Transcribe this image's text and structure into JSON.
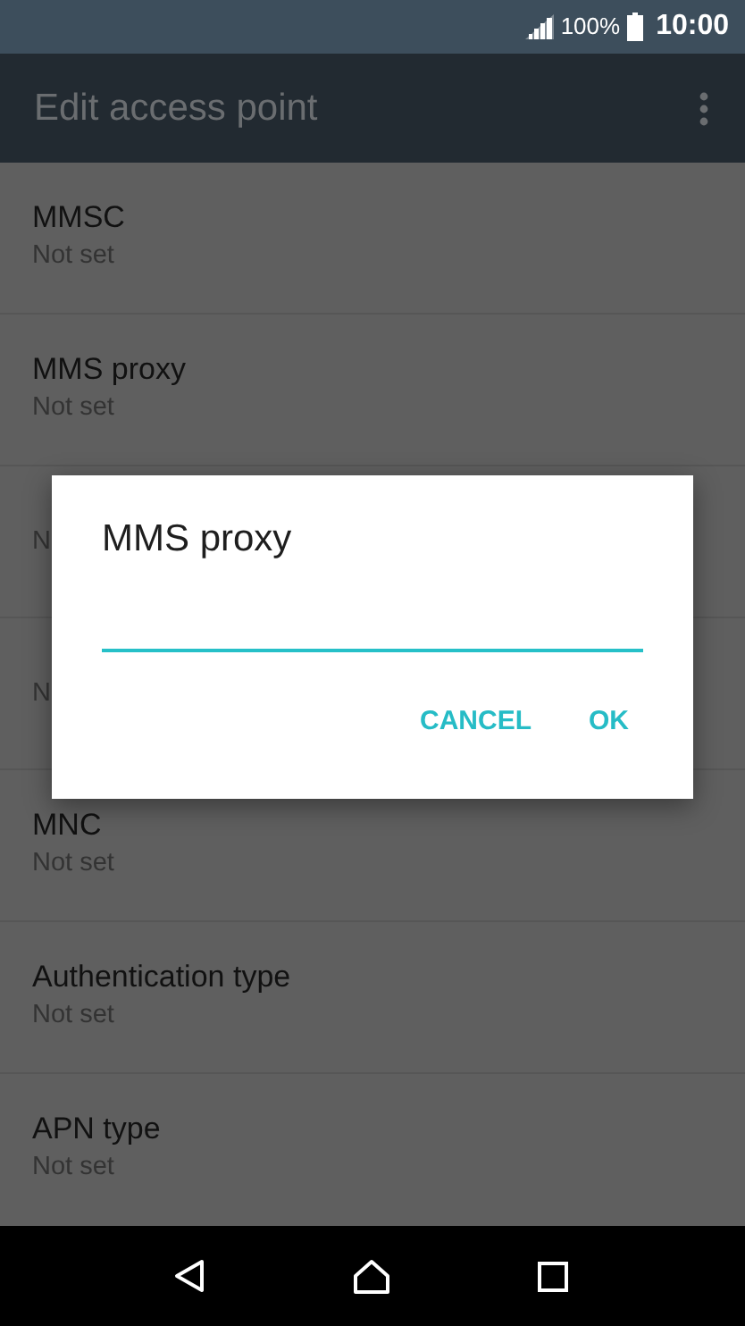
{
  "status_bar": {
    "battery": "100%",
    "time": "10:00"
  },
  "app_bar": {
    "title": "Edit access point"
  },
  "settings": [
    {
      "title": "MMSC",
      "value": "Not set"
    },
    {
      "title": "MMS proxy",
      "value": "Not set"
    },
    {
      "value": "N"
    },
    {
      "value": "N"
    },
    {
      "title": "MNC",
      "value": "Not set"
    },
    {
      "title": "Authentication type",
      "value": "Not set"
    },
    {
      "title": "APN type",
      "value": "Not set"
    }
  ],
  "dialog": {
    "title": "MMS proxy",
    "buttons": [
      "CANCEL",
      "OK"
    ]
  }
}
